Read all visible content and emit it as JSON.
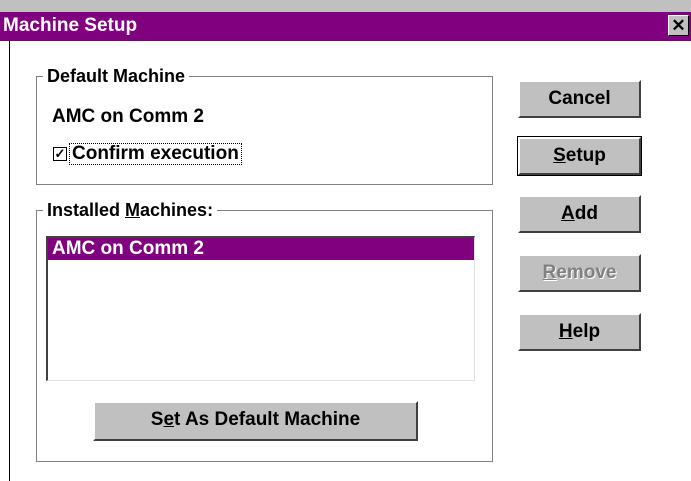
{
  "window": {
    "title": "Machine Setup",
    "close_glyph": "✕"
  },
  "default_group": {
    "label": "Default Machine",
    "machine_name": "AMC on Comm 2",
    "confirm_label": "Confirm execution",
    "confirm_checked": true,
    "check_glyph": "✓"
  },
  "installed_group": {
    "label_pre": "Installed ",
    "label_mnemonic": "M",
    "label_post": "achines:",
    "items": [
      "AMC on Comm 2"
    ],
    "selected_index": 0
  },
  "buttons": {
    "cancel": "Cancel",
    "setup_mnemonic": "S",
    "setup_rest": "etup",
    "add_mnemonic": "A",
    "add_rest": "dd",
    "remove_mnemonic": "R",
    "remove_rest": "emove",
    "help_mnemonic": "H",
    "help_rest": "elp",
    "set_default_pre": "S",
    "set_default_mnemonic": "e",
    "set_default_post": "t As Default Machine"
  },
  "colors": {
    "title_bar": "#800080",
    "selection": "#800080",
    "face": "#c0c0c0"
  }
}
